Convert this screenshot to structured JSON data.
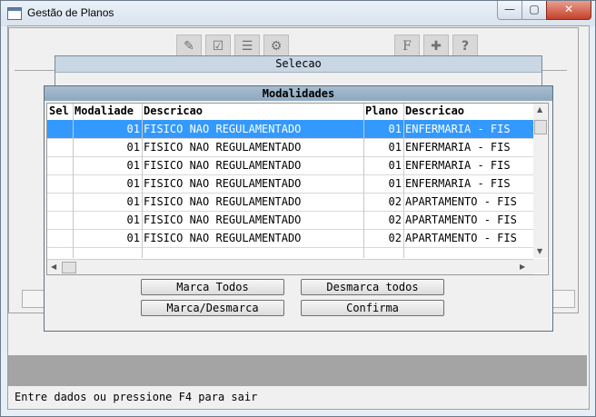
{
  "window": {
    "title": "Gestão de Planos",
    "minimize": "—",
    "maximize": "▢",
    "close": "✕"
  },
  "toolbar": [
    {
      "icon": "edit-icon",
      "glyph": "✎"
    },
    {
      "icon": "checklist-icon",
      "glyph": "☑"
    },
    {
      "icon": "list-icon",
      "glyph": "☰"
    },
    {
      "icon": "attach-icon",
      "glyph": "⚙"
    },
    {
      "icon": "formula-icon",
      "glyph": "F"
    },
    {
      "icon": "tools-icon",
      "glyph": "✚"
    },
    {
      "icon": "help-icon",
      "glyph": "?"
    }
  ],
  "selecao": {
    "title": "Selecao"
  },
  "modal": {
    "title": "Modalidades",
    "columns": [
      "Sel",
      "Modaliade",
      "Descricao",
      "Plano",
      "Descricao"
    ],
    "rows": [
      {
        "sel": "",
        "modalidade": "01",
        "descricao": "FISICO NAO REGULAMENTADO",
        "plano": "01",
        "plano_descricao": "ENFERMARIA - FIS"
      },
      {
        "sel": "",
        "modalidade": "01",
        "descricao": "FISICO NAO REGULAMENTADO",
        "plano": "01",
        "plano_descricao": "ENFERMARIA - FIS"
      },
      {
        "sel": "",
        "modalidade": "01",
        "descricao": "FISICO NAO REGULAMENTADO",
        "plano": "01",
        "plano_descricao": "ENFERMARIA - FIS"
      },
      {
        "sel": "",
        "modalidade": "01",
        "descricao": "FISICO NAO REGULAMENTADO",
        "plano": "01",
        "plano_descricao": "ENFERMARIA - FIS"
      },
      {
        "sel": "",
        "modalidade": "01",
        "descricao": "FISICO NAO REGULAMENTADO",
        "plano": "02",
        "plano_descricao": "APARTAMENTO - FIS"
      },
      {
        "sel": "",
        "modalidade": "01",
        "descricao": "FISICO NAO REGULAMENTADO",
        "plano": "02",
        "plano_descricao": "APARTAMENTO - FIS"
      },
      {
        "sel": "",
        "modalidade": "01",
        "descricao": "FISICO NAO REGULAMENTADO",
        "plano": "02",
        "plano_descricao": "APARTAMENTO - FIS"
      }
    ],
    "selected_row": 0,
    "buttons": {
      "marca_todos": "Marca Todos",
      "desmarca_todos": "Desmarca todos",
      "marca_desmarca": "Marca/Desmarca",
      "confirma": "Confirma"
    }
  },
  "status": {
    "text": "Entre dados ou pressione F4 para sair"
  },
  "colors": {
    "selection": "#3399ff",
    "modal_title": "#9db3c8",
    "graybar": "#a4a4a4"
  }
}
